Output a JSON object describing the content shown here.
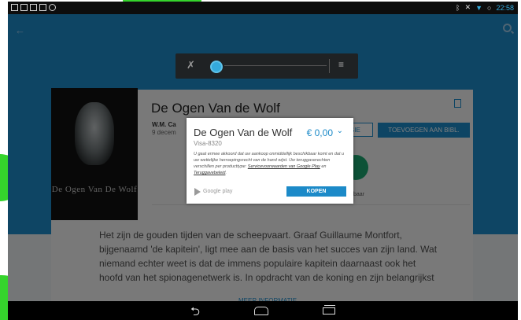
{
  "status_bar": {
    "time": "22:58",
    "icons": [
      "screenshot-icon",
      "gallery-icon",
      "mail-icon",
      "mail-icon",
      "chrome-icon"
    ],
    "right_icons": [
      "bluetooth-icon",
      "mute-icon",
      "wifi-icon",
      "battery-icon"
    ]
  },
  "action_bar": {
    "back_icon": "arrow-left-icon",
    "search_icon": "search-icon"
  },
  "volume": {
    "mute_icon": "mute-icon",
    "settings_icon": "equalizer-icon"
  },
  "book": {
    "cover_title": "De Ogen Van De Wolf",
    "title": "De Ogen Van de Wolf",
    "author": "W.M. Ca",
    "date": "9 decem",
    "sample_label": "SIE",
    "library_label": "TOEVOEGEN AAN BIBL.",
    "badge_label": "gelijkbaar",
    "description": "Het zijn de gouden tijden van de scheepvaart. Graaf Guillaume Montfort, bijgenaamd 'de kapitein', ligt mee aan de basis van het succes van zijn land. Wat niemand echter weet is dat de immens populaire kapitein daarnaast ook het hoofd van het spionagenetwerk is. In opdracht van de koning en zijn belangrijkst",
    "more_info": "MEER INFORMATIE"
  },
  "dialog": {
    "title": "De Ogen Van de Wolf",
    "price": "€ 0,00",
    "payment_method": "Visa-8320",
    "notice_prefix": "U gaat ermee akkoord dat uw aankoop onmiddellijk beschikbaar komt en dat u uw wettelijke herroepingsrecht van de hand wijst. Uw teruggaverechten verschillen per producttype:",
    "link1": "Servicevoorwaarden van Google Play",
    "notice_mid": "en",
    "link2": "Teruggavebeleid",
    "brand": "Google play",
    "buy_label": "KOPEN"
  },
  "colors": {
    "accent": "#1c8ac8",
    "badge": "#1aa56f",
    "frame_green": "#35d42c"
  }
}
